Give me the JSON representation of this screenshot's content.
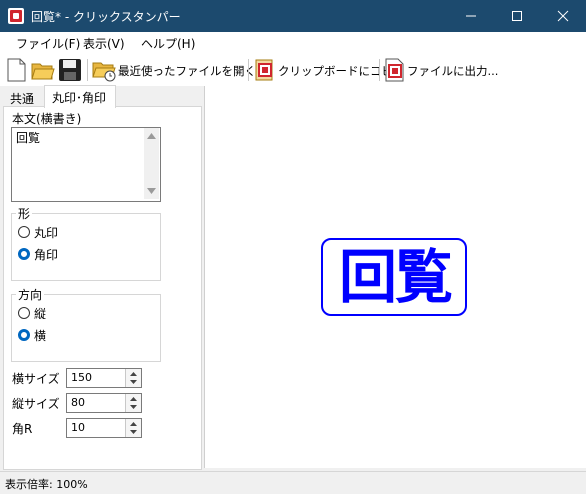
{
  "window": {
    "title": "回覧* - クリックスタンパー"
  },
  "menu": {
    "file": "ファイル(F)",
    "view": "表示(V)",
    "help": "ヘルプ(H)"
  },
  "toolbar": {
    "recent": "最近使ったファイルを開く...",
    "copy": "クリップボードにコピー",
    "output": "ファイルに出力..."
  },
  "tabs": {
    "common": "共通",
    "stamp": "丸印･角印"
  },
  "panel": {
    "body_label": "本文(横書き)",
    "body_text": "回覧",
    "shape_group": "形",
    "shape_round": "丸印",
    "shape_square": "角印",
    "shape_selected": "角印",
    "direction_group": "方向",
    "dir_vertical": "縦",
    "dir_horizontal": "横",
    "direction_selected": "横",
    "width_label": "横サイズ",
    "width_value": "150",
    "height_label": "縦サイズ",
    "height_value": "80",
    "corner_label": "角R",
    "corner_value": "10"
  },
  "preview": {
    "stamp_text": "回覧",
    "stamp_color": "#0000ff"
  },
  "status": {
    "zoom": "表示倍率: 100%"
  }
}
